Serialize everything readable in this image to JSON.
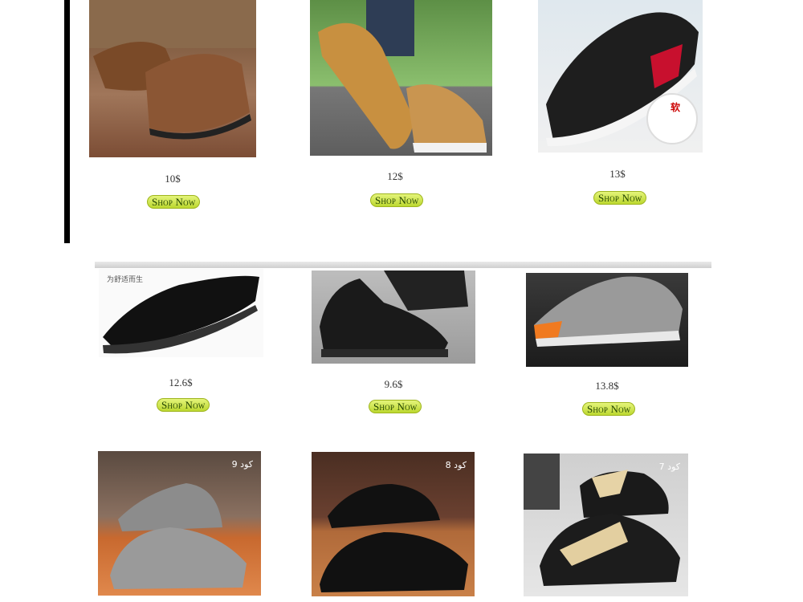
{
  "products": [
    {
      "price": "10$",
      "button": "Shop Now"
    },
    {
      "price": "12$",
      "button": "Shop Now"
    },
    {
      "price": "13$",
      "button": "Shop Now",
      "badge": "软"
    },
    {
      "price": "12.6$",
      "button": "Shop Now",
      "tag": "为舒适而生"
    },
    {
      "price": "9.6$",
      "button": "Shop Now"
    },
    {
      "price": "13.8$",
      "button": "Shop Now"
    },
    {
      "code": "كود 9"
    },
    {
      "code": "كود 8"
    },
    {
      "code": "كود 7"
    }
  ],
  "colors": {
    "button_fill": "#cfe43f",
    "button_border": "#9fb51f",
    "divider": "#000000"
  },
  "icons": [
    "shoe-image"
  ]
}
